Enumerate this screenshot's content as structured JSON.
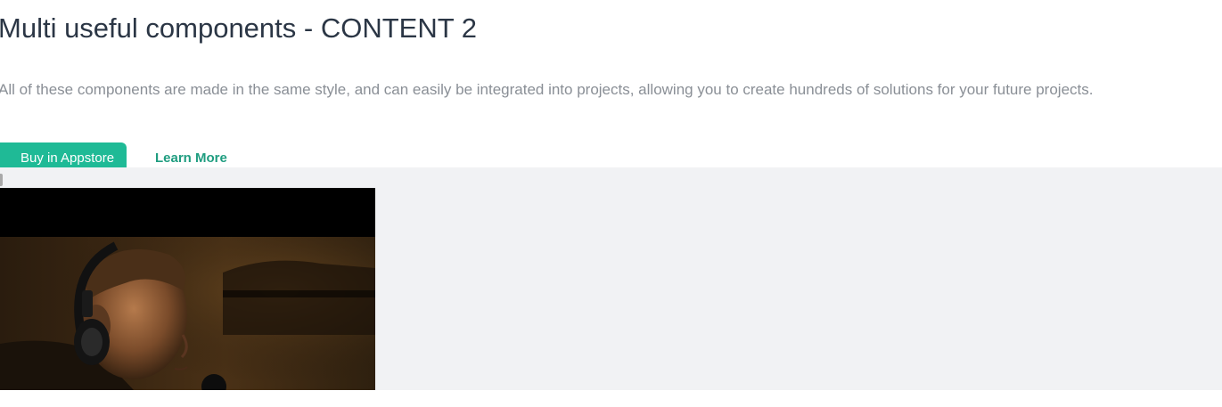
{
  "header": {
    "title": "Multi useful components - CONTENT 2",
    "description": "All of these components are made in the same style, and can easily be integrated into projects, allowing you to create hundreds of solutions for your future projects."
  },
  "actions": {
    "buy_label": "Buy in Appstore",
    "learn_label": "Learn More"
  },
  "colors": {
    "accent": "#1fba96",
    "link": "#1f9d80",
    "title": "#2b3645",
    "body_text": "#8a8f96",
    "panel_bg": "#f1f2f4"
  },
  "media": {
    "video_icon": "video-player"
  }
}
